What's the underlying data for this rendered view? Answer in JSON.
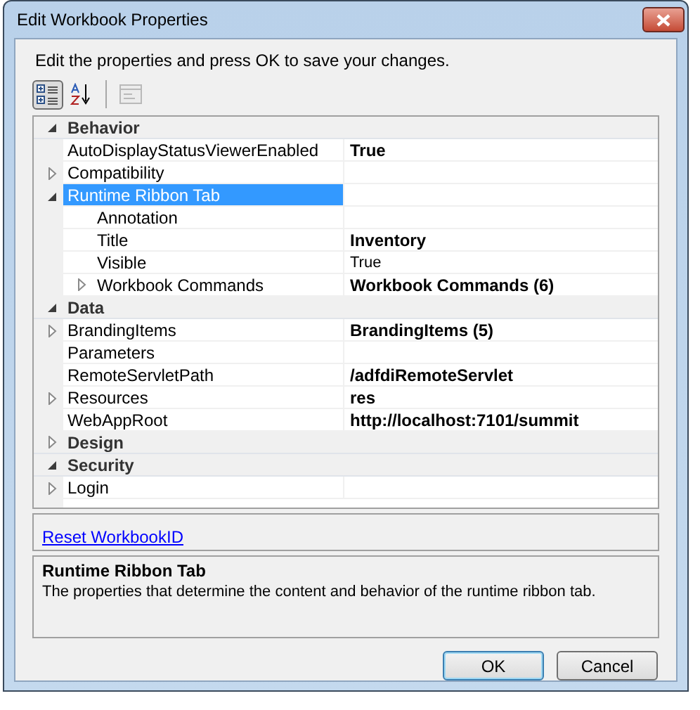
{
  "window": {
    "title": "Edit Workbook Properties"
  },
  "instructions": "Edit the properties and press OK to save your changes.",
  "toolbar": [
    {
      "kind": "categorized",
      "selected": true,
      "disabled": false
    },
    {
      "kind": "alphabetical",
      "selected": false,
      "disabled": false
    },
    {
      "kind": "property-pages",
      "selected": false,
      "disabled": true
    }
  ],
  "categories": [
    {
      "name": "Behavior",
      "expanded": true,
      "selected": false,
      "properties": [
        {
          "name": "AutoDisplayStatusViewerEnabled",
          "value": "True",
          "modified": true,
          "selected": false
        },
        {
          "name": "Compatibility",
          "expanded": false,
          "selected": false
        },
        {
          "name": "Runtime Ribbon Tab",
          "expanded": true,
          "selected": true,
          "children": [
            {
              "name": "Annotation",
              "selected": false
            },
            {
              "name": "Title",
              "value": "Inventory",
              "modified": true,
              "selected": false
            },
            {
              "name": "Visible",
              "value": "True",
              "modified": false,
              "selected": false
            },
            {
              "name": "Workbook Commands",
              "value": "Workbook Commands (6)",
              "modified": true,
              "expanded": false,
              "selected": false
            }
          ]
        }
      ]
    },
    {
      "name": "Data",
      "expanded": true,
      "selected": false,
      "properties": [
        {
          "name": "BrandingItems",
          "value": "BrandingItems (5)",
          "modified": true,
          "expanded": false,
          "selected": false
        },
        {
          "name": "Parameters",
          "selected": false
        },
        {
          "name": "RemoteServletPath",
          "value": "/adfdiRemoteServlet",
          "modified": true,
          "selected": false
        },
        {
          "name": "Resources",
          "value": "res",
          "modified": true,
          "expanded": false,
          "selected": false
        },
        {
          "name": "WebAppRoot",
          "value": "http://localhost:7101/summit",
          "modified": true,
          "selected": false
        }
      ]
    },
    {
      "name": "Design",
      "expanded": false,
      "selected": false
    },
    {
      "name": "Security",
      "expanded": true,
      "selected": false,
      "properties": [
        {
          "name": "Login",
          "expanded": false,
          "selected": false
        }
      ]
    }
  ],
  "commands": [
    {
      "label": "Reset WorkbookID"
    }
  ],
  "description": {
    "title": "Runtime Ribbon Tab",
    "text": "The properties that determine the content and behavior of the runtime ribbon tab."
  },
  "buttons": [
    {
      "label": "OK",
      "default": true
    },
    {
      "label": "Cancel",
      "default": false
    }
  ]
}
